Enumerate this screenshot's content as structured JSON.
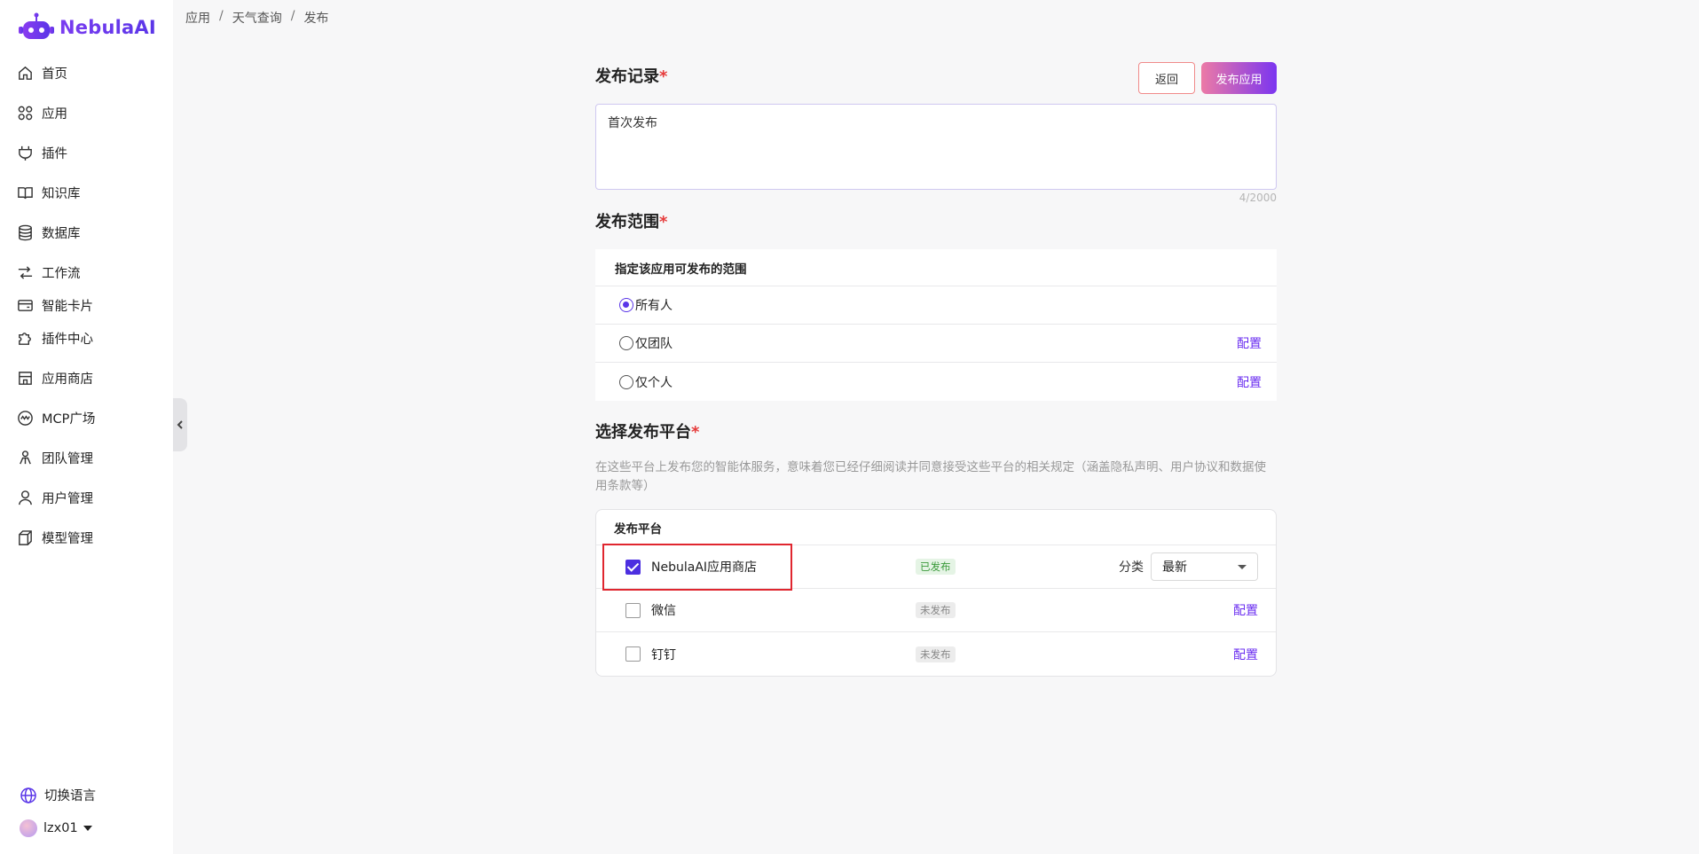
{
  "app": {
    "name": "NebulaAI"
  },
  "sidebar": {
    "items": [
      {
        "label": "首页",
        "icon": "home-icon"
      },
      {
        "label": "应用",
        "icon": "apps-grid-icon"
      },
      {
        "label": "插件",
        "icon": "plug-icon"
      },
      {
        "label": "知识库",
        "icon": "book-icon"
      },
      {
        "label": "数据库",
        "icon": "database-icon"
      },
      {
        "label": "工作流",
        "icon": "workflow-icon"
      },
      {
        "label": "智能卡片",
        "icon": "card-icon"
      },
      {
        "label": "插件中心",
        "icon": "puzzle-icon"
      },
      {
        "label": "应用商店",
        "icon": "store-icon"
      },
      {
        "label": "MCP广场",
        "icon": "mcp-icon"
      },
      {
        "label": "团队管理",
        "icon": "team-icon"
      },
      {
        "label": "用户管理",
        "icon": "user-icon"
      },
      {
        "label": "模型管理",
        "icon": "cube-icon"
      }
    ],
    "language_label": "切换语言",
    "username": "lzx01"
  },
  "breadcrumb": [
    "应用",
    "天气查询",
    "发布"
  ],
  "record": {
    "title": "发布记录",
    "required_mark": "*",
    "back_label": "返回",
    "publish_label": "发布应用",
    "text": "首次发布",
    "counter": "4/2000"
  },
  "scope": {
    "title": "发布范围",
    "required_mark": "*",
    "header": "指定该应用可发布的范围",
    "options": [
      {
        "label": "所有人",
        "selected": true,
        "config": ""
      },
      {
        "label": "仅团队",
        "selected": false,
        "config": "配置"
      },
      {
        "label": "仅个人",
        "selected": false,
        "config": "配置"
      }
    ]
  },
  "platforms": {
    "title": "选择发布平台",
    "required_mark": "*",
    "description": "在这些平台上发布您的智能体服务，意味着您已经仔细阅读并同意接受这些平台的相关规定（涵盖隐私声明、用户协议和数据使用条款等）",
    "header": "发布平台",
    "category_label": "分类",
    "category_value": "最新",
    "rows": [
      {
        "name": "NebulaAI应用商店",
        "checked": true,
        "status": "已发布",
        "config": ""
      },
      {
        "name": "微信",
        "checked": false,
        "status": "未发布",
        "config": "配置"
      },
      {
        "name": "钉钉",
        "checked": false,
        "status": "未发布",
        "config": "配置"
      }
    ]
  },
  "colors": {
    "accent": "#5a36e8",
    "link": "#6a2df0",
    "required": "#e63b3b",
    "highlight": "#e0262f"
  }
}
